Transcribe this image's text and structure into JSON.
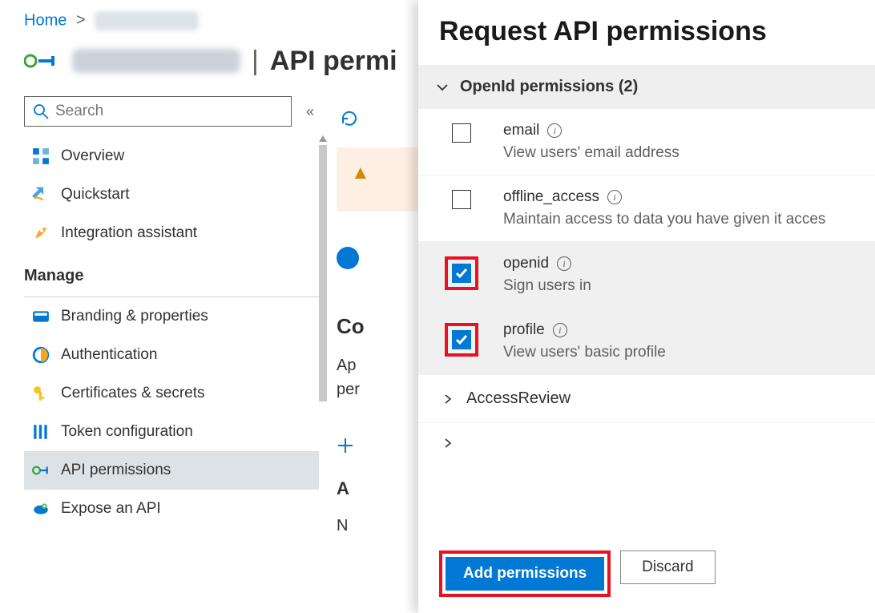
{
  "breadcrumb": {
    "home": "Home"
  },
  "page_title_suffix": "API permi",
  "search": {
    "placeholder": "Search"
  },
  "nav": {
    "overview": "Overview",
    "quickstart": "Quickstart",
    "integration_assistant": "Integration assistant",
    "manage_header": "Manage",
    "branding": "Branding & properties",
    "authentication": "Authentication",
    "certificates": "Certificates & secrets",
    "token_config": "Token configuration",
    "api_permissions": "API permissions",
    "expose_api": "Expose an API"
  },
  "main": {
    "refresh": "Refresh",
    "conf_header_partial": "Co",
    "conf_text_line1_partial": "Ap",
    "conf_text_line2_partial": "per",
    "api_heading_partial": "A",
    "no_text_partial": "N"
  },
  "panel": {
    "title": "Request API permissions",
    "group_title": "OpenId permissions (2)",
    "permissions": [
      {
        "name": "email",
        "desc": "View users' email address",
        "checked": false,
        "highlighted": false
      },
      {
        "name": "offline_access",
        "desc": "Maintain access to data you have given it acces",
        "checked": false,
        "highlighted": false
      },
      {
        "name": "openid",
        "desc": "Sign users in",
        "checked": true,
        "highlighted": true
      },
      {
        "name": "profile",
        "desc": "View users' basic profile",
        "checked": true,
        "highlighted": true
      }
    ],
    "collapsed_group": "AccessReview",
    "add_button": "Add permissions",
    "discard_button": "Discard"
  }
}
